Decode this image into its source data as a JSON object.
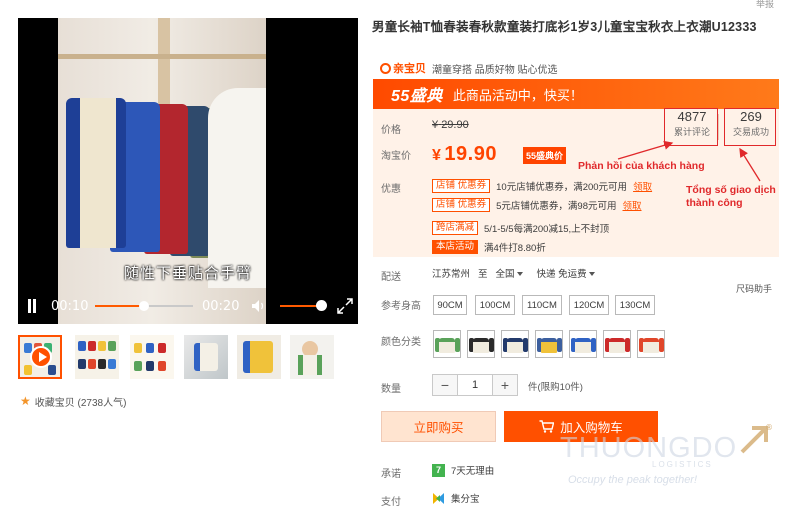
{
  "product": {
    "title": "男童长袖T恤春装春秋款童装打底衫1岁3儿童宝宝秋衣上衣潮U12333",
    "shop_logo_text": "亲宝贝",
    "shop_tagline": "潮童穿搭 品质好物 贴心优选",
    "report_label": "举报"
  },
  "video": {
    "caption": "随性下垂贴合手臂",
    "current_time": "00:10",
    "total_time": "00:20",
    "progress": 0.5,
    "volume": 1.0
  },
  "thumbnails": [
    {
      "name": "thumb-video",
      "active": true
    },
    {
      "name": "thumb-2",
      "active": false
    },
    {
      "name": "thumb-3",
      "active": false
    },
    {
      "name": "thumb-4",
      "active": false
    },
    {
      "name": "thumb-5",
      "active": false
    },
    {
      "name": "thumb-6",
      "active": false
    }
  ],
  "favorite": {
    "label": "收藏宝贝 (2738人气)"
  },
  "promo": {
    "badge": "55盛典",
    "text": "此商品活动中，快买！"
  },
  "price": {
    "orig_label": "价格",
    "orig_currency": "¥",
    "orig_value": "29.90",
    "cur_label": "淘宝价",
    "cur_currency": "¥",
    "cur_value": "19.90",
    "tag": "55盛典价"
  },
  "stats": {
    "reviews_value": "4877",
    "reviews_label": "累计评论",
    "sales_value": "269",
    "sales_label": "交易成功"
  },
  "annotations": {
    "reviews_note": "Phản hồi của khách hàng",
    "sales_note": "Tổng số giao dịch thành công"
  },
  "coupons": {
    "label": "优惠",
    "rows": [
      {
        "badge": "店铺 优惠券",
        "text": "10元店铺优惠券，满200元可用",
        "link": "领取"
      },
      {
        "badge": "店铺 优惠券",
        "text": "5元店铺优惠券，满98元可用",
        "link": "领取"
      },
      {
        "badge": "跨店满减",
        "text": "5/1-5/5每满200减15,上不封顶",
        "link": ""
      },
      {
        "badge": "本店活动",
        "text": "满4件打8.80折",
        "link": ""
      }
    ]
  },
  "shipping": {
    "label": "配送",
    "from": "江苏常州",
    "to_prefix": "至",
    "to": "全国",
    "delivery": "快递 免运费"
  },
  "helper": "尺码助手",
  "sizes": {
    "label": "参考身高",
    "options": [
      "90CM",
      "100CM",
      "110CM",
      "120CM",
      "130CM"
    ]
  },
  "colors": {
    "label": "颜色分类",
    "swatches": [
      {
        "name": "green",
        "body": "#f1ecdf",
        "sleeve": "#5aa25a"
      },
      {
        "name": "black",
        "body": "#f1ecdf",
        "sleeve": "#2a2a2a"
      },
      {
        "name": "navy",
        "body": "#f1ecdf",
        "sleeve": "#233a6b"
      },
      {
        "name": "yellow",
        "body": "#f0c23a",
        "sleeve": "#3c5f9e"
      },
      {
        "name": "blue",
        "body": "#f1ecdf",
        "sleeve": "#2f62c4"
      },
      {
        "name": "red",
        "body": "#f1ecdf",
        "sleeve": "#cc2a2a"
      },
      {
        "name": "orange",
        "body": "#f1ecdf",
        "sleeve": "#e0462a"
      }
    ]
  },
  "quantity": {
    "label": "数量",
    "value": "1",
    "note": "件(限购10件)"
  },
  "buttons": {
    "buy": "立即购买",
    "cart": "加入购物车"
  },
  "promise": {
    "label": "承诺",
    "text": "7天无理由",
    "icon_text": "7"
  },
  "payment": {
    "label": "支付",
    "text": "集分宝"
  },
  "watermark": {
    "brand": "THUONGDO",
    "sub": "LOGISTICS",
    "slogan": "Occupy the peak together!",
    "mark": "®"
  },
  "colors_theme": {
    "accent": "#ff5000",
    "price": "#ff4400",
    "panel": "#fff2e8",
    "annotation": "#e0292b"
  }
}
